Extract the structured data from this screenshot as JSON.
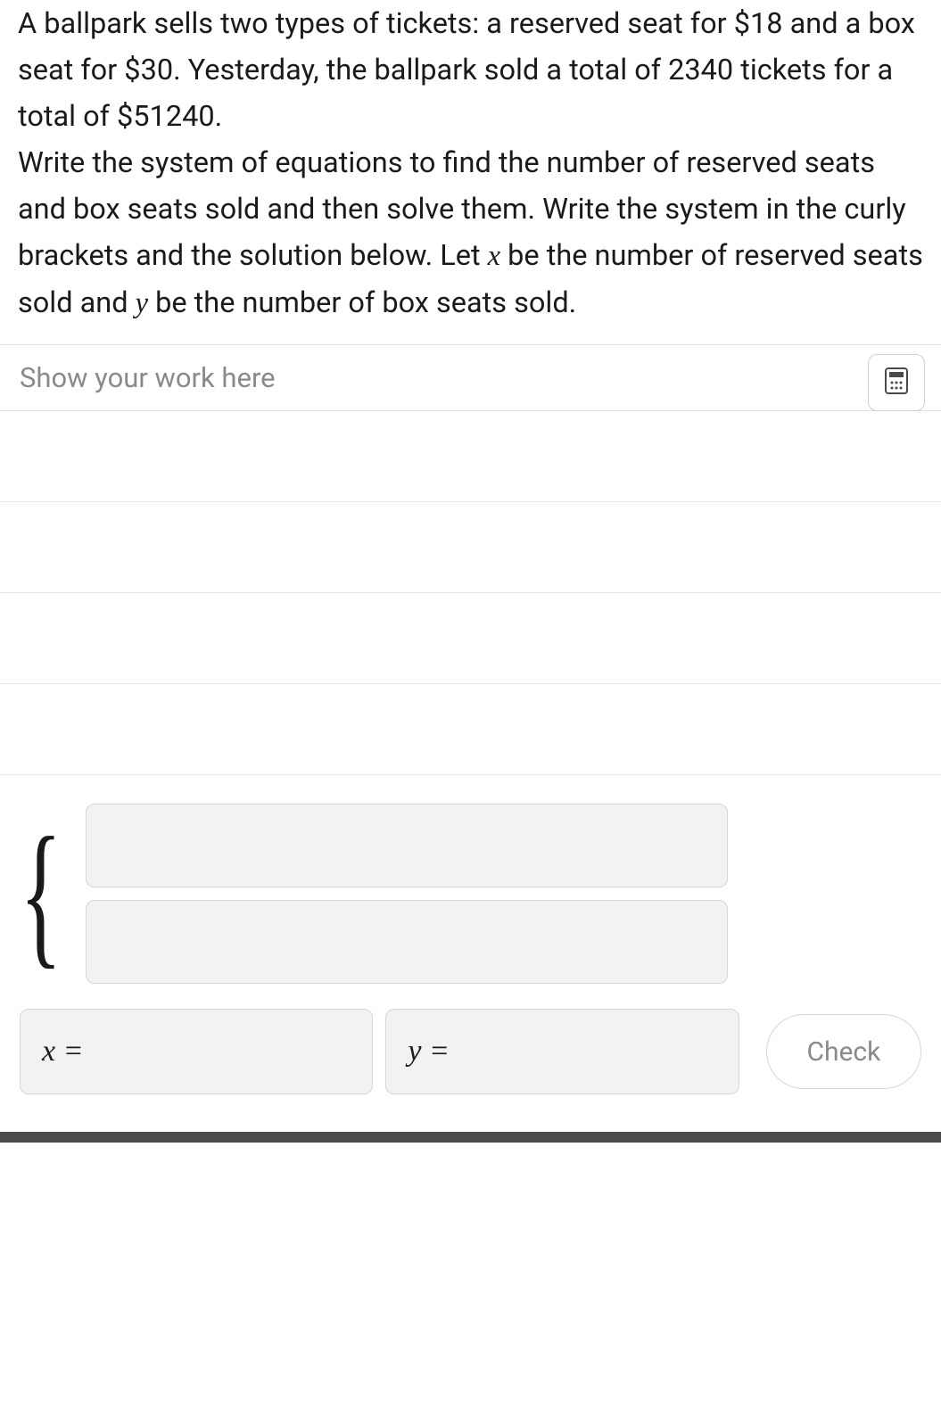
{
  "problem": {
    "p1_a": "A ballpark sells two types of tickets: a reserved seat for $",
    "price1": "18",
    "p1_b": " and a box seat for $",
    "price2": "30",
    "p1_c": ". Yesterday, the ballpark sold a total of ",
    "total_tickets": "2340",
    "p1_d": " tickets for a total of $",
    "total_money": "51240",
    "p1_e": ".",
    "p2_a": "Write the system of equations to find the number of reserved seats and box seats sold and then solve them. Write the system in the curly brackets and the solution below. Let ",
    "var_x": "x",
    "p2_b": " be the number of reserved seats sold and ",
    "var_y": "y",
    "p2_c": " be the number of box seats sold."
  },
  "work": {
    "placeholder": "Show your work here"
  },
  "answers": {
    "x_label": "x =",
    "y_label": "y =",
    "check_label": "Check"
  }
}
